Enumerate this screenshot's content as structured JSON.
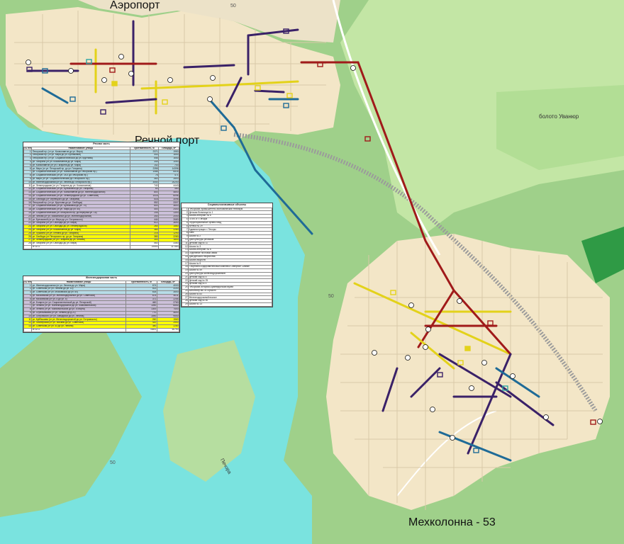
{
  "map": {
    "labels": {
      "aeroport": "Аэропорт",
      "river_port": "Речной порт",
      "mekhkolonna": "Мехколонна - 53",
      "boloto": "болото Уванюр",
      "pechora": "Печора"
    },
    "colors": {
      "river": "#7ae3df",
      "forest": "#9fd08a",
      "forest_light": "#c3e6a5",
      "town": "#f3e6c7",
      "red_route": "#a01a1a",
      "blue_route": "#1f6b97",
      "purple_route": "#3a2168",
      "yellow_route": "#e3d21a",
      "teal_route": "#2ca6a5"
    }
  },
  "river_table": {
    "caption": "Речная часть",
    "headers": [
      "№ п/п",
      "Наименование улицы",
      "Протяженность, м",
      "Площадь, м²"
    ],
    "rows": [
      {
        "n": "1",
        "name": "Печорский пр. (от ул. Космонавтов до ул. Мира)",
        "len": "2371",
        "area": "1950",
        "c": "c-blue"
      },
      {
        "n": "2",
        "name": "Печорский пр. (от ул. Мира до ул. Булгаковой)",
        "len": "443",
        "area": "1640",
        "c": "c-blue"
      },
      {
        "n": "3",
        "name": "Печорский пр. (от ул. Социалистической до ул. Круглова)",
        "len": "546",
        "area": "1640",
        "c": "c-blue"
      },
      {
        "n": "4",
        "name": "ул. Гагарина (от ул. Космонавтов до ул. Мира)",
        "len": "349",
        "area": "1050",
        "c": "c-blue"
      },
      {
        "n": "5",
        "name": "ул. Космонавтов (от ул. Гагарина до ул. Мира)",
        "len": "142",
        "area": "743",
        "c": "c-blue"
      },
      {
        "n": "6",
        "name": "ул. Мира (от ул. Печорский пр. до ул. Гагарина)",
        "len": "2398",
        "area": "14396",
        "c": "c-blue"
      },
      {
        "n": "7",
        "name": "ул. Социалистическая (от ул. Космонавтов до Печорский пр.)",
        "len": "1086",
        "area": "6516",
        "c": "c-blue"
      },
      {
        "n": "8",
        "name": "ул. Социалистическая (от ул. 1К/3 до Печорский пр.)",
        "len": "76",
        "area": "471",
        "c": "c-blue"
      },
      {
        "n": "9",
        "name": "ул. Мира (от ул. Социалистическая до Печорского пр.)",
        "len": "460",
        "area": "2800",
        "c": "c-blue"
      },
      {
        "n": "10",
        "name": "ул. Железнодорожная (от ул. Ленина до Печорского пр.)",
        "len": "3050",
        "area": "20200",
        "c": "c-blue"
      },
      {
        "n": "11",
        "name": "ул. Ленинградская (от ул. Гагарина до ул. Космонавтов)",
        "len": "740",
        "area": "4440",
        "c": "c-white"
      },
      {
        "n": "12",
        "name": "ул. Социалистическая (от ул. Булгаковой до ул. Гагарина)",
        "len": "60",
        "area": "480",
        "c": "c-purple"
      },
      {
        "n": "13",
        "name": "ул. Социалистическая (от ул. Космонавтов до ул. Железнодорожной)",
        "len": "800",
        "area": "4800",
        "c": "c-purple"
      },
      {
        "n": "14",
        "name": "ул. Социалистическая (от ул. Ленинградской до ул. Советской)",
        "len": "1016",
        "area": "6096",
        "c": "c-purple"
      },
      {
        "n": "15",
        "name": "ул. Свободы (от Чернецкого до ул. Гагарина)",
        "len": "516",
        "area": "3096",
        "c": "c-purple"
      },
      {
        "n": "16",
        "name": "Печорский пр. (от ул. Круглова до ул. Свободы)",
        "len": "552",
        "area": "3307",
        "c": "c-purple"
      },
      {
        "n": "17",
        "name": "ул. Социалистическая (от ул. Булгаковой до ул. 70)",
        "len": "600",
        "area": "3600",
        "c": "c-purple"
      },
      {
        "n": "18",
        "name": "ул. Социалистическая (от ул. Мира до ул. 60)",
        "len": "400",
        "area": "2400",
        "c": "c-purple"
      },
      {
        "n": "19",
        "name": "ул. Социалистическая (от Печорского пр. до переулка ул. 18)",
        "len": "205",
        "area": "1300",
        "c": "c-purple"
      },
      {
        "n": "20",
        "name": "ул. Чехова (от ул. Вокзальной до ул. Железнодорожной)",
        "len": "340",
        "area": "2000",
        "c": "c-purple"
      },
      {
        "n": "21",
        "name": "ул. Булгаковой (от ул. Мира до ул. Островского)",
        "len": "444",
        "area": "2680",
        "c": "c-purple"
      },
      {
        "n": "22",
        "name": "ул. Гагарина (от ул. Свободы до ул. Мира)",
        "len": "612",
        "area": "3690",
        "c": "c-purple"
      },
      {
        "n": "23",
        "name": "ул. Гагарина (от ул. Свободы до ул. Ленинградской)",
        "len": "260",
        "area": "1560",
        "c": "c-yellow"
      },
      {
        "n": "24",
        "name": "ул. Гагарина (от ул. Космонавтов до ул. Мира)",
        "len": "380",
        "area": "2280",
        "c": "c-yellow"
      },
      {
        "n": "25",
        "name": "ул. Пушкина (от ул. Ленина до ул. Гагарина)",
        "len": "215",
        "area": "1290",
        "c": "c-yellow"
      },
      {
        "n": "26",
        "name": "ул. Свободы (от Печорского пр. до ул. Гагарина)",
        "len": "380",
        "area": "2280",
        "c": "c-yellow"
      },
      {
        "n": "27",
        "name": "ул. Ленинградская (от ул. Гагарина до ул. Чехова)",
        "len": "300",
        "area": "1800",
        "c": "c-yellow"
      },
      {
        "n": "28",
        "name": "ул. Гагарина (от ул. Свободы до ул. Мира)",
        "len": "560",
        "area": "3380",
        "c": "c-white"
      }
    ],
    "total_label": "ИТОГО",
    "total_len": "19493",
    "total_area": "117383"
  },
  "rail_table": {
    "caption": "Железнодорожная часть",
    "headers": [
      "№ п/п",
      "Наименование улицы",
      "Протяженность, м",
      "Площадь, м²"
    ],
    "rows": [
      {
        "n": "1",
        "name": "ул. Железнодорожная (от ул. Ленина до ул. Мира)",
        "len": "674",
        "area": "4000",
        "c": "c-blue"
      },
      {
        "n": "2",
        "name": "ул. Советская (от ул. Ленина до ул. 10)",
        "len": "513",
        "area": "3100",
        "c": "c-blue"
      },
      {
        "n": "3",
        "name": "ул. Советская (от ул. Московской до ул. 60)",
        "len": "618",
        "area": "3500",
        "c": "c-blue"
      },
      {
        "n": "4",
        "name": "ул. Московская (от ул. Железнодорожной до ул. Советской)",
        "len": "674",
        "area": "4011",
        "c": "c-purple"
      },
      {
        "n": "5",
        "name": "ул. Московская (от ул. 8 до ул. 5)",
        "len": "371",
        "area": "2254",
        "c": "c-purple"
      },
      {
        "n": "6",
        "name": "ул. 8 марта (от ул. Социалистической до ул. Печорской)",
        "len": "460",
        "area": "2760",
        "c": "c-purple"
      },
      {
        "n": "7",
        "name": "ул. Ленина (от ул. Железнодорожной до ул. Комсомольской)",
        "len": "1090",
        "area": "6540",
        "c": "c-purple"
      },
      {
        "n": "8",
        "name": "ул. Ленина (от ул. Комсомольской до ул. 8 Марта)",
        "len": "1300",
        "area": "7400",
        "c": "c-purple"
      },
      {
        "n": "9",
        "name": "ул. Стрельникова (от ул. Ленина до д.21)",
        "len": "770",
        "area": "4600",
        "c": "c-purple"
      },
      {
        "n": "10",
        "name": "ул. Островского (от ул. Заводской до ул. Ленина)",
        "len": "1590",
        "area": "9540",
        "c": "c-purple"
      },
      {
        "n": "11",
        "name": "ул. Куйбышева (от ул. Железнодорожной до ул. Островского)",
        "len": "260",
        "area": "1560",
        "c": "c-yellow"
      },
      {
        "n": "12",
        "name": "ул. Пионерская (от ул. Москвы до ул. Советской)",
        "len": "420",
        "area": "2900",
        "c": "c-yellow"
      },
      {
        "n": "13",
        "name": "ул. Советская (от ул. 43 до ул. Ленина)",
        "len": "380",
        "area": "2280",
        "c": "c-yellow"
      }
    ],
    "total_label": "ИТОГО",
    "total_len": "75891",
    "total_area": "60790"
  },
  "social_table": {
    "caption": "Социальнозначимые объекты",
    "rows": [
      {
        "n": "1",
        "name": "Печорский промышленно-экономический техникум"
      },
      {
        "n": "2",
        "name": "Детская больница № 1"
      },
      {
        "n": "3",
        "name": "Школа-интернат № 6"
      },
      {
        "n": "4",
        "name": "ЧТИП и г. Печора"
      },
      {
        "n": "5",
        "name": "Территориальные органы МВД"
      },
      {
        "n": "6",
        "name": "Аптека № 29"
      },
      {
        "n": "7",
        "name": "Администрация г. Печоры"
      },
      {
        "n": "8",
        "name": "Банк"
      },
      {
        "n": "9",
        "name": "Школа № 2"
      },
      {
        "n": "10",
        "name": "Дом культуры речников"
      },
      {
        "n": "11",
        "name": "Детский сад № 11"
      },
      {
        "n": "12",
        "name": "Школа № 3"
      },
      {
        "n": "13",
        "name": "Школа-интернат № 6"
      },
      {
        "n": "14",
        "name": "Отделение почтовой связи"
      },
      {
        "n": "15",
        "name": "Дом детского творчества"
      },
      {
        "n": "16",
        "name": "Школа искусств"
      },
      {
        "n": "17",
        "name": "Школа № 9"
      },
      {
        "n": "18",
        "name": "Спортивно-оздоровительный комплекс Северное Сияние"
      },
      {
        "n": "19",
        "name": "Школа № 49"
      },
      {
        "n": "20",
        "name": "Дом культуры железнодорожников"
      },
      {
        "n": "21",
        "name": "Детский сад № 5"
      },
      {
        "n": "22",
        "name": "Детский сад № 25"
      },
      {
        "n": "23",
        "name": "Детский сад № 4"
      },
      {
        "n": "24",
        "name": "Печорский историко-краеведческий музей"
      },
      {
        "n": "25",
        "name": "Кинотеатр им. М.Горького"
      },
      {
        "n": "26",
        "name": "Школа № 83"
      },
      {
        "n": "27",
        "name": "Железнодорожный вокзал"
      },
      {
        "n": "28",
        "name": "Детский сад № 50"
      },
      {
        "n": "29",
        "name": "Школа № 13"
      }
    ]
  }
}
